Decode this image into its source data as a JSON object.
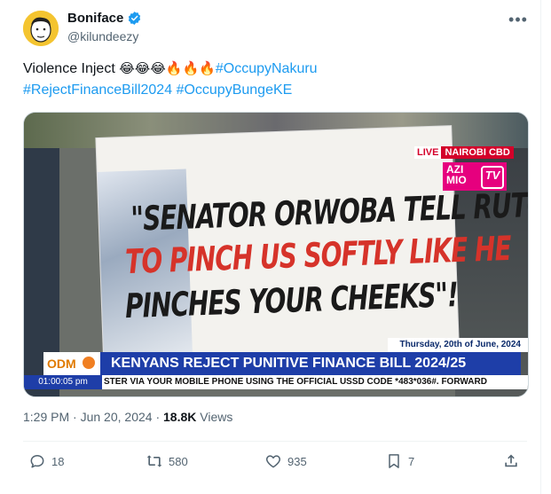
{
  "author": {
    "name": "Boniface",
    "handle": "@kilundeezy",
    "verified_icon": "verified-badge-icon",
    "verified_color": "#1d9bf0"
  },
  "tweet": {
    "text_lead": "Violence Inject ",
    "emojis_laugh": "😂😂😂",
    "emojis_fire": "🔥🔥🔥",
    "hashtags": [
      "#OccupyNakuru",
      "#RejectFinanceBill2024",
      "#OccupyBungeKE"
    ]
  },
  "media": {
    "banner_line1": "\"SENATOR ORWOBA TELL RUTO",
    "banner_line2": "TO PINCH US SOFTLY LIKE HE",
    "banner_line3": "PINCHES YOUR CHEEKS\"!",
    "live_tag": "LIVE",
    "live_place": "NAIROBI CBD",
    "channel_logo_line1": "AZI",
    "channel_logo_line2": "MIO",
    "channel_logo_tv": "TV",
    "date": "Thursday, 20th of June, 2024",
    "sponsor_logo": "ODM",
    "headline": "KENYANS REJECT PUNITIVE FINANCE BILL 2024/25",
    "clock": "01:00:05 pm",
    "ticker": "STER VIA YOUR MOBILE PHONE USING THE OFFICIAL USSD CODE *483*036#. FORWARD"
  },
  "meta": {
    "time": "1:29 PM",
    "separator": " · ",
    "date": "Jun 20, 2024",
    "views_count": "18.8K",
    "views_label": " Views"
  },
  "actions": {
    "replies": "18",
    "reposts": "580",
    "likes": "935",
    "bookmarks": "7"
  },
  "colors": {
    "link": "#1d9bf0",
    "secondary_text": "#536471",
    "headline_bar": "#1e3ea8",
    "live_red": "#d4002a"
  }
}
